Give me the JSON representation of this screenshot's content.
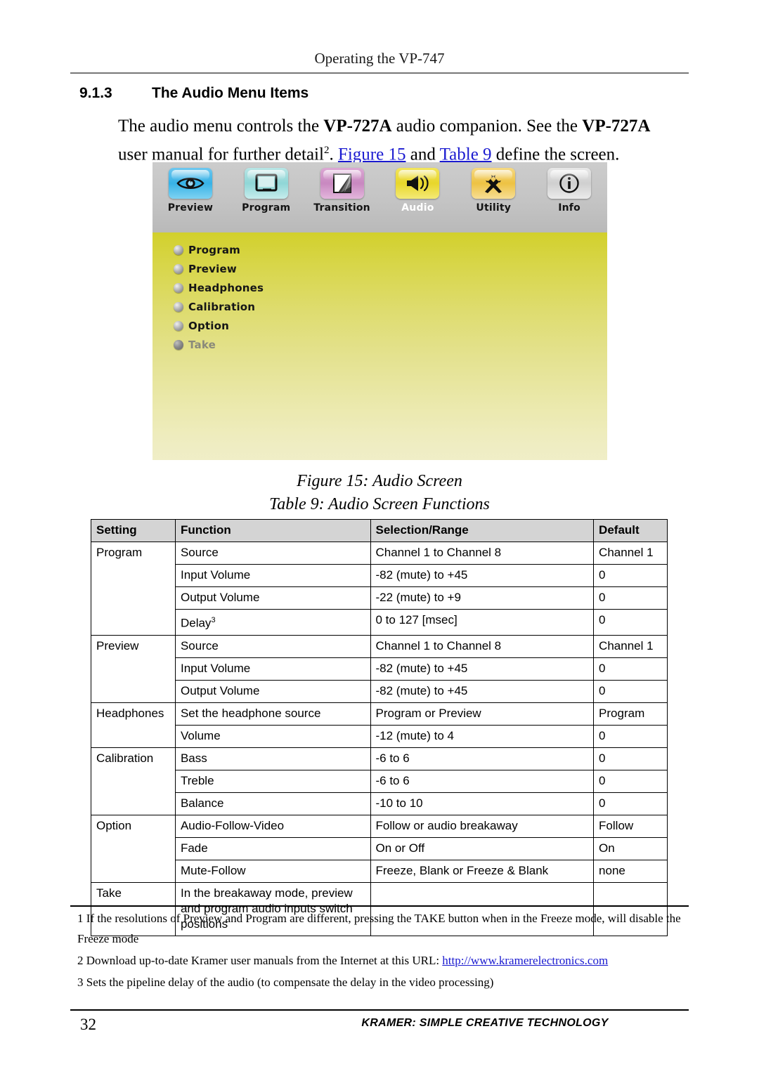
{
  "header": {
    "running_head": "Operating the VP-747"
  },
  "section": {
    "number": "9.1.3",
    "title": "The Audio Menu Items"
  },
  "paragraph": {
    "part1": "The audio menu controls the ",
    "bold1": "VP-727A",
    "part2": " audio companion. See the ",
    "bold2": "VP-727A",
    "part3": " user manual for further detail",
    "footnote_marker": "2",
    "part4": ". ",
    "xref1": "Figure 15",
    "part5": " and ",
    "xref2": "Table 9",
    "part6": " define the screen."
  },
  "figure": {
    "icons": [
      {
        "label": "Preview",
        "icon": "eye-icon",
        "active": false
      },
      {
        "label": "Program",
        "icon": "monitor-icon",
        "active": false
      },
      {
        "label": "Transition",
        "icon": "page-peel-icon",
        "active": false
      },
      {
        "label": "Audio",
        "icon": "speaker-icon",
        "active": true
      },
      {
        "label": "Utility",
        "icon": "tools-icon",
        "active": false
      },
      {
        "label": "Info",
        "icon": "info-icon",
        "active": false
      }
    ],
    "menu_items": [
      {
        "label": "Program",
        "dimmed": false
      },
      {
        "label": "Preview",
        "dimmed": false
      },
      {
        "label": "Headphones",
        "dimmed": false
      },
      {
        "label": "Calibration",
        "dimmed": false
      },
      {
        "label": "Option",
        "dimmed": false
      },
      {
        "label": "Take",
        "dimmed": true
      }
    ],
    "colors": {
      "bar_background": "#c4c4c4",
      "menu_gradient_top": "#d2d02c",
      "menu_gradient_bottom": "#f0eecb",
      "active_label": "#ffffff"
    }
  },
  "captions": {
    "figure": "Figure 15: Audio Screen",
    "table": "Table 9: Audio Screen Functions"
  },
  "table": {
    "headers": [
      "Setting",
      "Function",
      "Selection/Range",
      "Default"
    ],
    "rows": [
      {
        "setting": "Program",
        "rowspan": 4,
        "function": "Source",
        "range": "Channel 1 to Channel 8",
        "default": "Channel 1"
      },
      {
        "setting": null,
        "function": "Input Volume",
        "range": "-82 (mute) to +45",
        "default": "0"
      },
      {
        "setting": null,
        "function": "Output Volume",
        "range": "-22 (mute) to +9",
        "default": "0"
      },
      {
        "setting": null,
        "function": "Delay",
        "function_sup": "3",
        "range": "0 to 127 [msec]",
        "default": "0"
      },
      {
        "setting": "Preview",
        "rowspan": 3,
        "function": "Source",
        "range": "Channel 1 to Channel 8",
        "default": "Channel 1"
      },
      {
        "setting": null,
        "function": "Input Volume",
        "range": "-82 (mute) to +45",
        "default": "0"
      },
      {
        "setting": null,
        "function": "Output Volume",
        "range": "-82 (mute) to +45",
        "default": "0"
      },
      {
        "setting": "Headphones",
        "rowspan": 2,
        "function": "Set the headphone source",
        "range": "Program or Preview",
        "default": "Program"
      },
      {
        "setting": null,
        "function": "Volume",
        "range": "-12 (mute) to 4",
        "default": "0"
      },
      {
        "setting": "Calibration",
        "rowspan": 3,
        "function": "Bass",
        "range": "-6 to 6",
        "default": "0"
      },
      {
        "setting": null,
        "function": "Treble",
        "range": "-6 to 6",
        "default": "0"
      },
      {
        "setting": null,
        "function": "Balance",
        "range": "-10 to 10",
        "default": "0"
      },
      {
        "setting": "Option",
        "rowspan": 3,
        "function": "Audio-Follow-Video",
        "range": "Follow or audio breakaway",
        "default": "Follow"
      },
      {
        "setting": null,
        "function": "Fade",
        "range": "On or Off",
        "default": "On"
      },
      {
        "setting": null,
        "function": "Mute-Follow",
        "range": "Freeze, Blank or Freeze & Blank",
        "default": "none"
      },
      {
        "setting": "Take",
        "rowspan": 1,
        "function": "In the breakaway mode, preview and program audio inputs switch positions",
        "range": "",
        "default": ""
      }
    ]
  },
  "footnotes": [
    {
      "number": "1",
      "text": "If the resolutions of Preview and Program are different, pressing the TAKE button when in the Freeze mode, will disable the Freeze mode"
    },
    {
      "number": "2",
      "text": "Download up-to-date Kramer user manuals from the Internet at this URL: ",
      "url": "http://www.kramerelectronics.com"
    },
    {
      "number": "3",
      "text": "Sets the pipeline delay of the audio (to compensate the delay in the video processing)"
    }
  ],
  "footer": {
    "page_number": "32",
    "tagline": "KRAMER: SIMPLE CREATIVE TECHNOLOGY"
  }
}
